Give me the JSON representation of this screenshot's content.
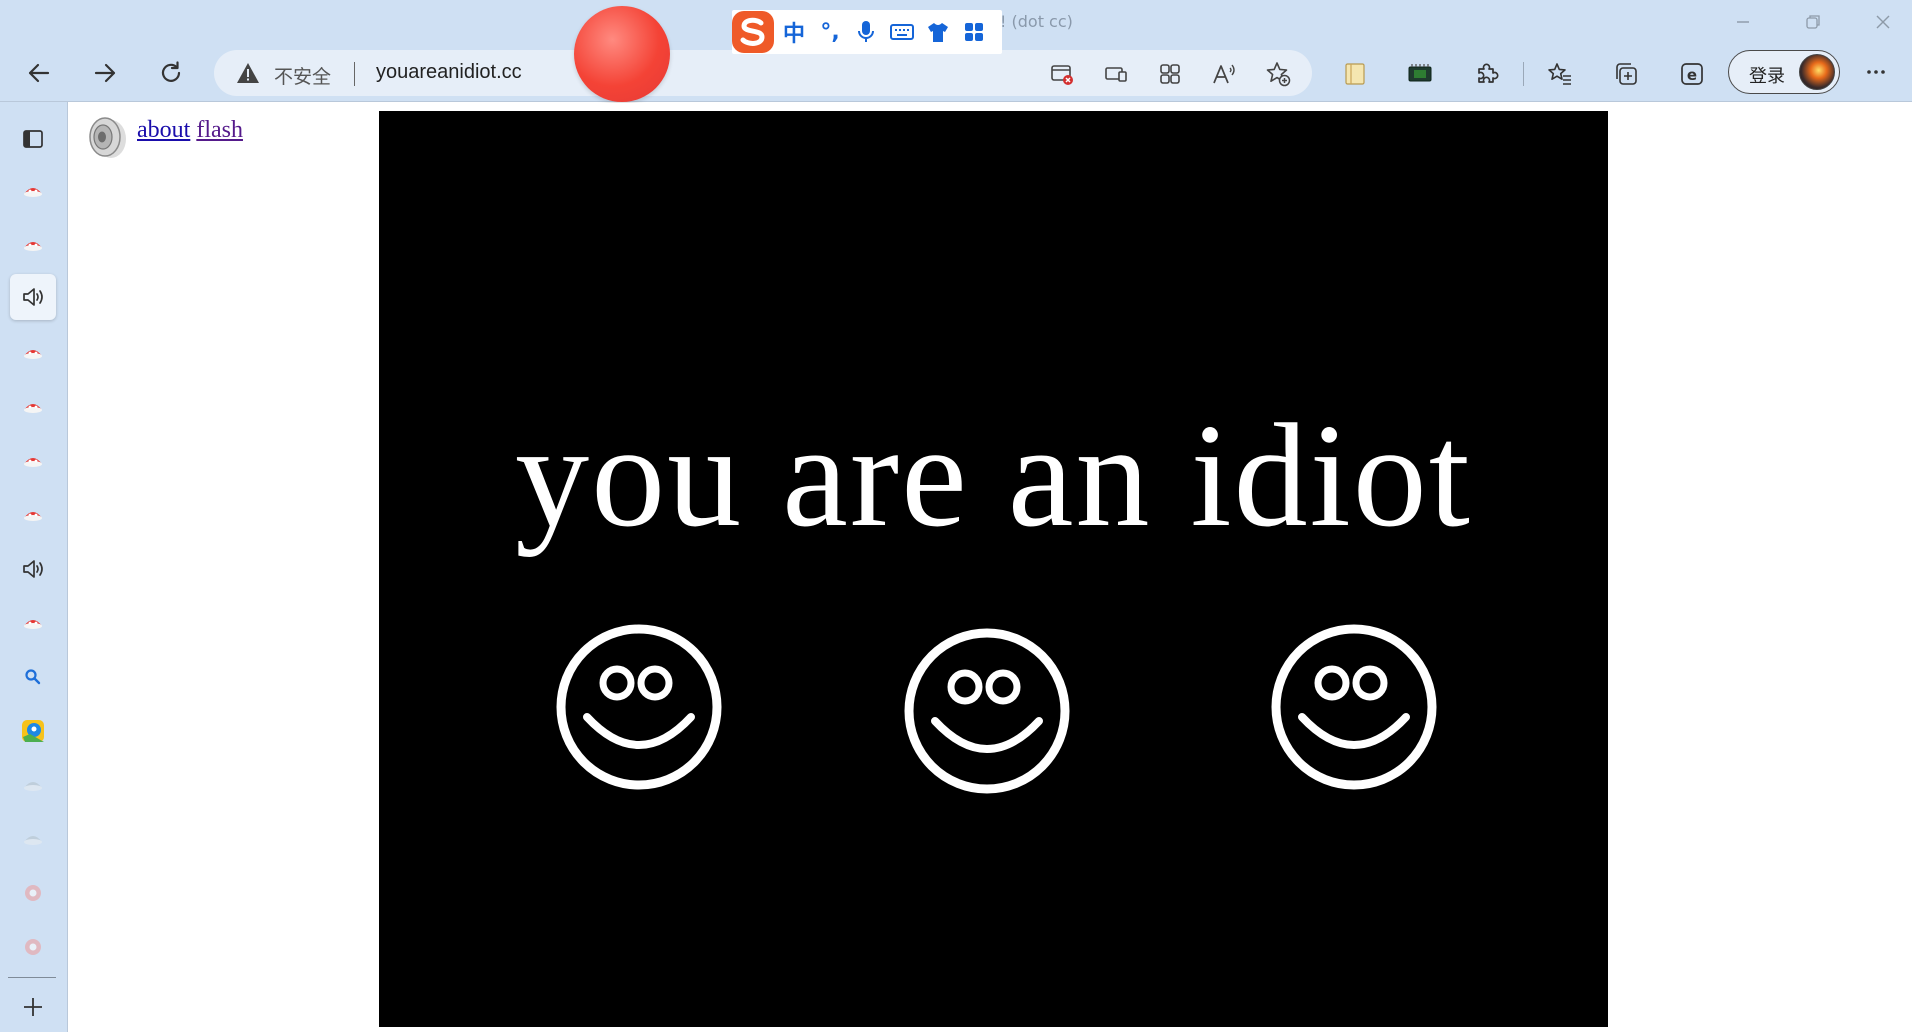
{
  "window": {
    "title": "! (dot cc)"
  },
  "ime": {
    "mode": "中",
    "punct": "°,"
  },
  "addressbar": {
    "security_label": "不安全",
    "url": "youareanidiot.cc"
  },
  "profile": {
    "login_label": "登录"
  },
  "page": {
    "links": [
      {
        "label": "about"
      },
      {
        "label": "flash"
      }
    ],
    "headline": "you are an idiot"
  },
  "colors": {
    "chrome": "#cfe0f3",
    "flash_bg": "#000000",
    "flash_fg": "#ffffff",
    "link": "#1a0dab"
  }
}
